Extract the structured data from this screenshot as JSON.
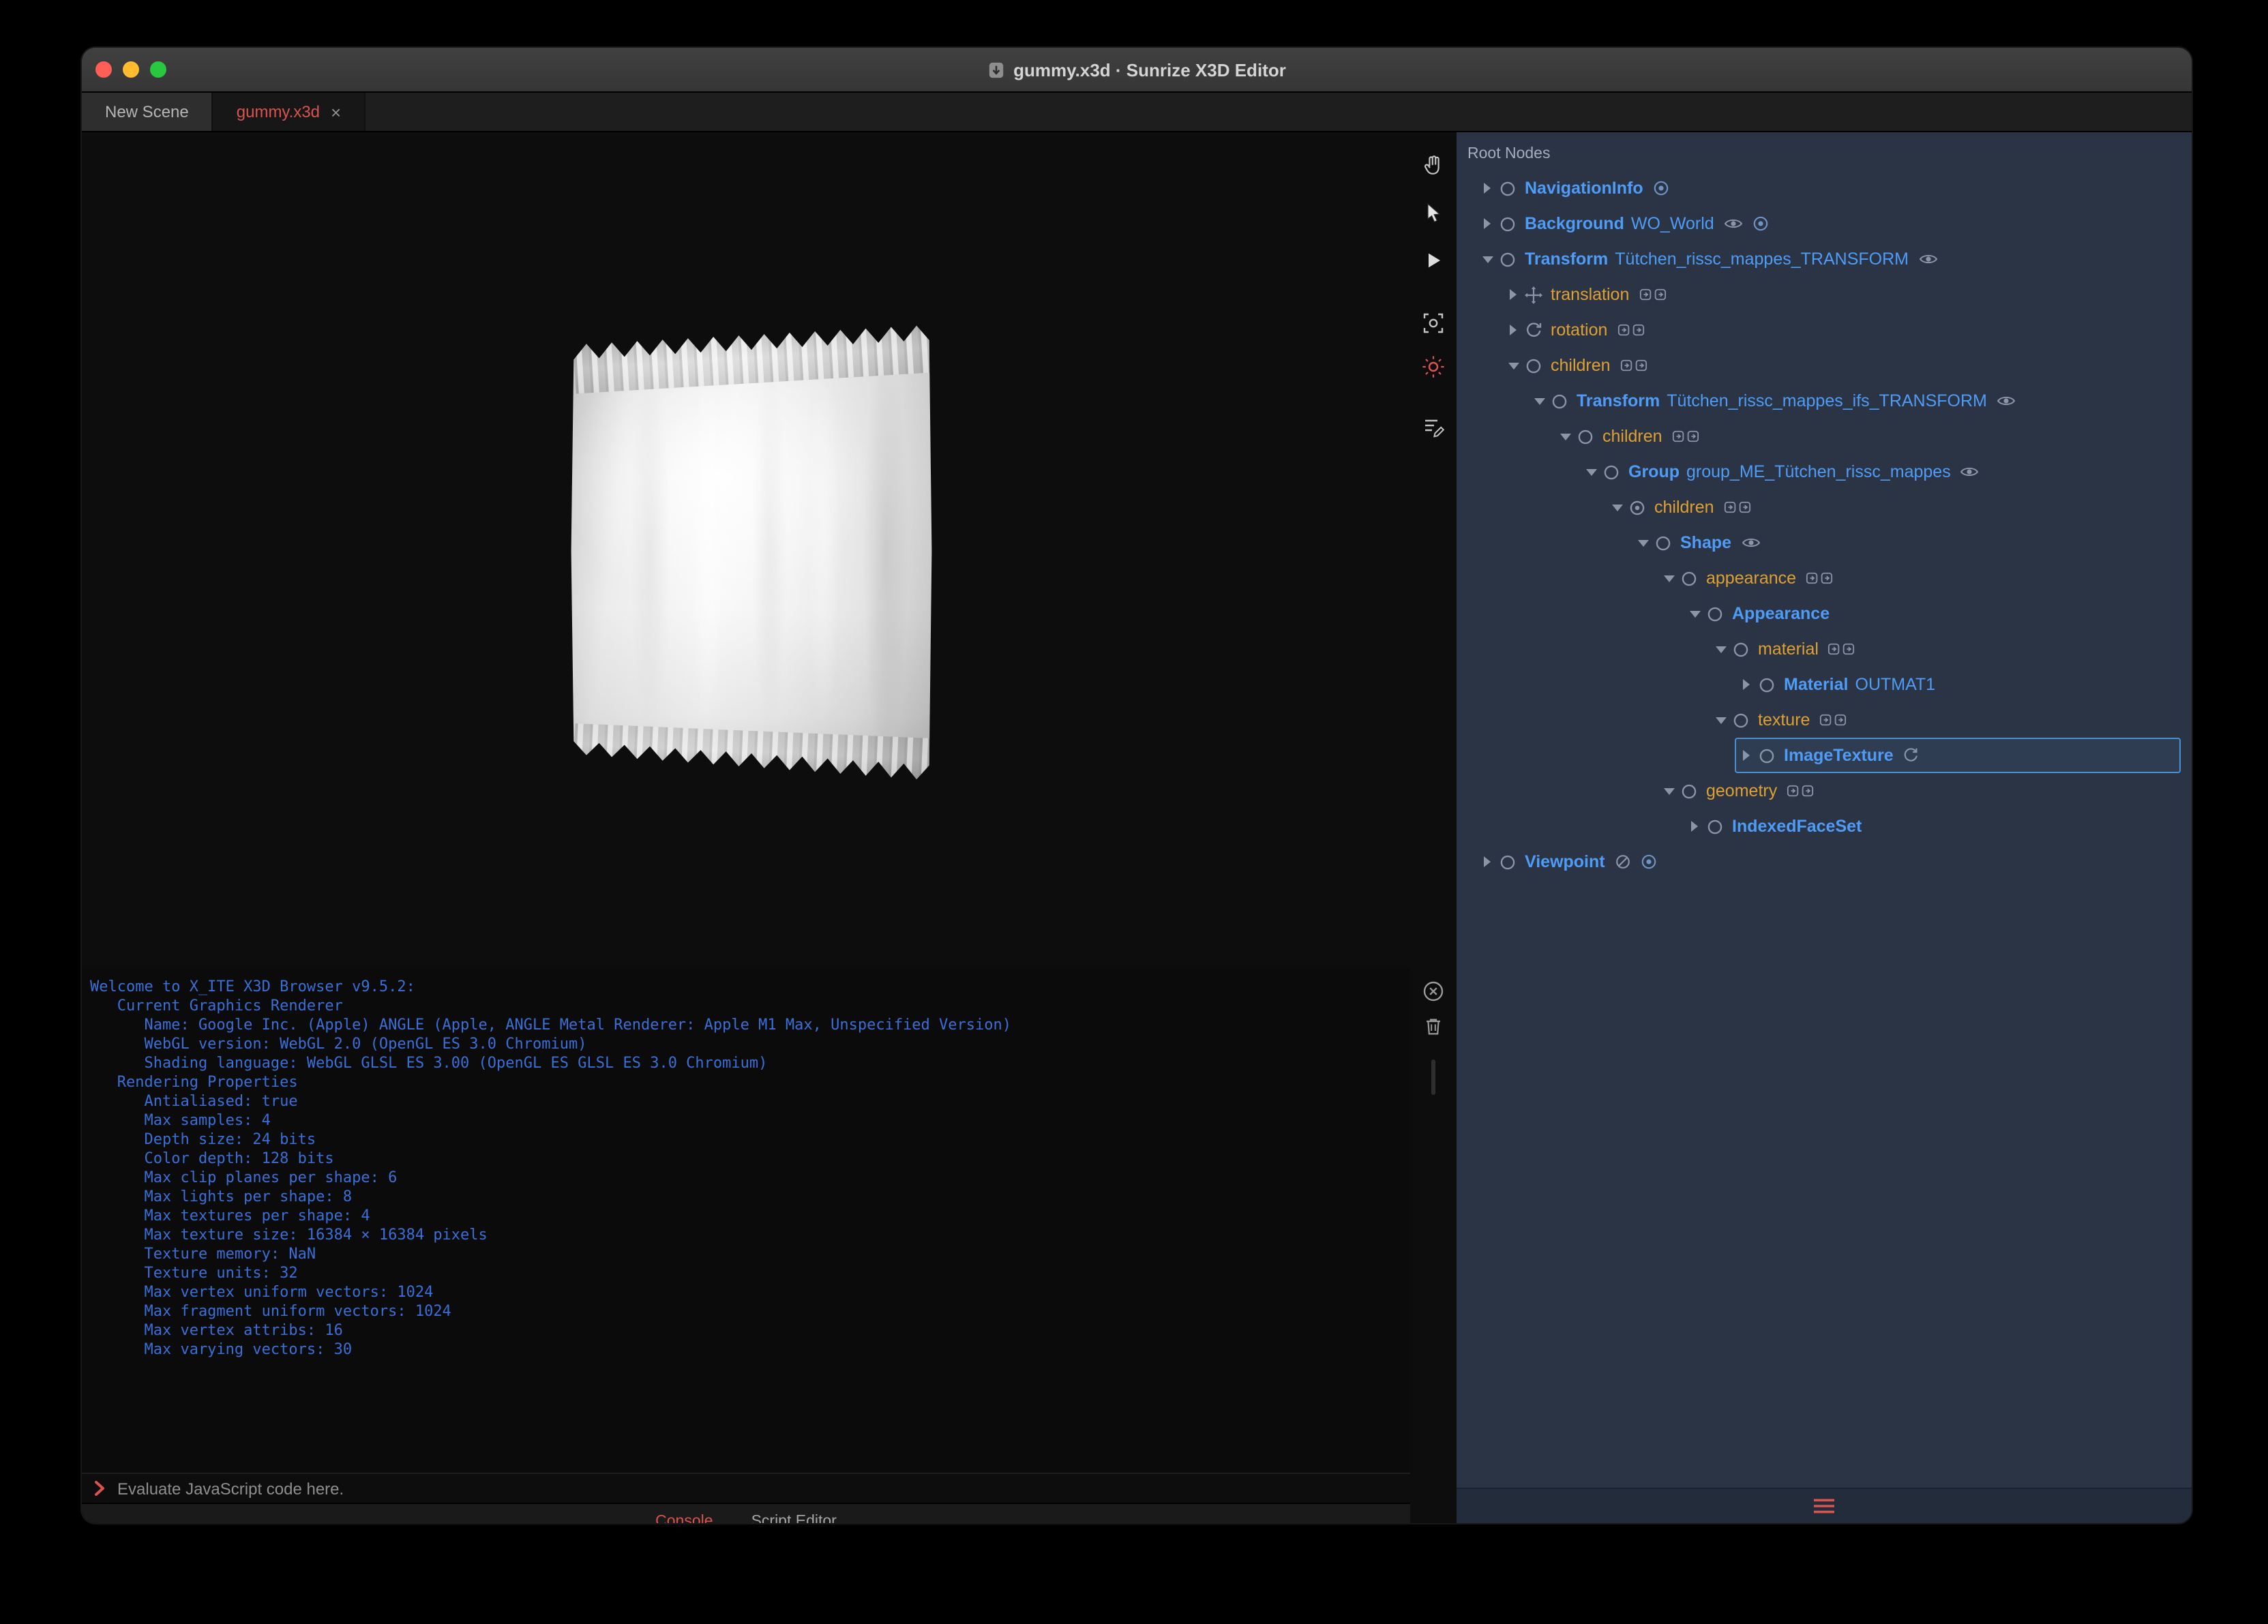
{
  "colors": {
    "accent_red": "#d9534f",
    "node_blue": "#4f9cf7",
    "field_orange": "#dfa033",
    "console_blue": "#3a6fd8",
    "selection_blue": "#4a8fd0",
    "panel_bg": "#2b3444",
    "traffic_red": "#ff5f57",
    "traffic_yellow": "#febc2e",
    "traffic_green": "#28c840"
  },
  "titlebar": {
    "title": "gummy.x3d · Sunrize X3D Editor"
  },
  "tabs": [
    {
      "label": "New Scene",
      "active": false
    },
    {
      "label": "gummy.x3d",
      "active": true,
      "close": "×"
    }
  ],
  "toolbar": {
    "tools": [
      "pan-tool",
      "select-tool",
      "play-tool",
      "frame-view-tool",
      "lighting-tool",
      "script-tool"
    ],
    "console_tools": [
      "clear-console-button",
      "delete-console-button"
    ]
  },
  "outline": {
    "header": "Root Nodes",
    "rows": [
      {
        "depth": 0,
        "expand": "closed",
        "icon": "circle",
        "type": "node",
        "name": "NavigationInfo",
        "suffix": "",
        "trail": [
          "target"
        ]
      },
      {
        "depth": 0,
        "expand": "closed",
        "icon": "circle",
        "type": "node",
        "name": "Background",
        "suffix": "WO_World",
        "trail": [
          "eye",
          "target"
        ]
      },
      {
        "depth": 0,
        "expand": "open",
        "icon": "circle",
        "type": "node",
        "name": "Transform",
        "suffix": "Tütchen_rissc_mappes_TRANSFORM",
        "trail": [
          "eye"
        ]
      },
      {
        "depth": 1,
        "expand": "closed",
        "icon": "move",
        "type": "field",
        "name": "translation",
        "suffix": "",
        "trail": [
          "routes"
        ]
      },
      {
        "depth": 1,
        "expand": "closed",
        "icon": "rotate",
        "type": "field",
        "name": "rotation",
        "suffix": "",
        "trail": [
          "routes"
        ]
      },
      {
        "depth": 1,
        "expand": "open",
        "icon": "circle",
        "type": "field",
        "name": "children",
        "suffix": "",
        "trail": [
          "routes"
        ]
      },
      {
        "depth": 2,
        "expand": "open",
        "icon": "circle",
        "type": "node",
        "name": "Transform",
        "suffix": "Tütchen_rissc_mappes_ifs_TRANSFORM",
        "trail": [
          "eye"
        ]
      },
      {
        "depth": 3,
        "expand": "open",
        "icon": "circle",
        "type": "field",
        "name": "children",
        "suffix": "",
        "trail": [
          "routes"
        ]
      },
      {
        "depth": 4,
        "expand": "open",
        "icon": "circle",
        "type": "node",
        "name": "Group",
        "suffix": "group_ME_Tütchen_rissc_mappes",
        "trail": [
          "eye"
        ]
      },
      {
        "depth": 5,
        "expand": "open",
        "icon": "circle-dot",
        "type": "field",
        "name": "children",
        "suffix": "",
        "trail": [
          "routes"
        ]
      },
      {
        "depth": 6,
        "expand": "open",
        "icon": "circle",
        "type": "node",
        "name": "Shape",
        "suffix": "",
        "trail": [
          "eye"
        ]
      },
      {
        "depth": 7,
        "expand": "open",
        "icon": "circle",
        "type": "field",
        "name": "appearance",
        "suffix": "",
        "trail": [
          "routes"
        ]
      },
      {
        "depth": 8,
        "expand": "open",
        "icon": "circle",
        "type": "node",
        "name": "Appearance",
        "suffix": "",
        "trail": []
      },
      {
        "depth": 9,
        "expand": "open",
        "icon": "circle",
        "type": "field",
        "name": "material",
        "suffix": "",
        "trail": [
          "routes"
        ]
      },
      {
        "depth": 10,
        "expand": "closed",
        "icon": "circle",
        "type": "node",
        "name": "Material",
        "suffix": "OUTMAT1",
        "trail": []
      },
      {
        "depth": 9,
        "expand": "open",
        "icon": "circle",
        "type": "field",
        "name": "texture",
        "suffix": "",
        "trail": [
          "routes"
        ]
      },
      {
        "depth": 10,
        "expand": "closed",
        "icon": "circle",
        "type": "node",
        "name": "ImageTexture",
        "suffix": "",
        "trail": [
          "refresh"
        ],
        "selected": true
      },
      {
        "depth": 7,
        "expand": "open",
        "icon": "circle",
        "type": "field",
        "name": "geometry",
        "suffix": "",
        "trail": [
          "routes"
        ]
      },
      {
        "depth": 8,
        "expand": "closed",
        "icon": "circle",
        "type": "node",
        "name": "IndexedFaceSet",
        "suffix": "",
        "trail": []
      },
      {
        "depth": 0,
        "expand": "closed",
        "icon": "circle",
        "type": "node",
        "name": "Viewpoint",
        "suffix": "",
        "trail": [
          "slash-circle",
          "target"
        ]
      }
    ]
  },
  "console": {
    "lines": [
      "Welcome to X_ITE X3D Browser v9.5.2:",
      "   Current Graphics Renderer",
      "      Name: Google Inc. (Apple) ANGLE (Apple, ANGLE Metal Renderer: Apple M1 Max, Unspecified Version)",
      "      WebGL version: WebGL 2.0 (OpenGL ES 3.0 Chromium)",
      "      Shading language: WebGL GLSL ES 3.00 (OpenGL ES GLSL ES 3.0 Chromium)",
      "   Rendering Properties",
      "      Antialiased: true",
      "      Max samples: 4",
      "      Depth size: 24 bits",
      "      Color depth: 128 bits",
      "      Max clip planes per shape: 6",
      "      Max lights per shape: 8",
      "      Max textures per shape: 4",
      "      Max texture size: 16384 × 16384 pixels",
      "      Texture memory: NaN",
      "      Texture units: 32",
      "      Max vertex uniform vectors: 1024",
      "      Max fragment uniform vectors: 1024",
      "      Max vertex attribs: 16",
      "      Max varying vectors: 30"
    ],
    "prompt": "Evaluate JavaScript code here."
  },
  "footer": {
    "tabs": [
      {
        "label": "Console",
        "active": true
      },
      {
        "label": "Script Editor",
        "active": false
      }
    ]
  }
}
